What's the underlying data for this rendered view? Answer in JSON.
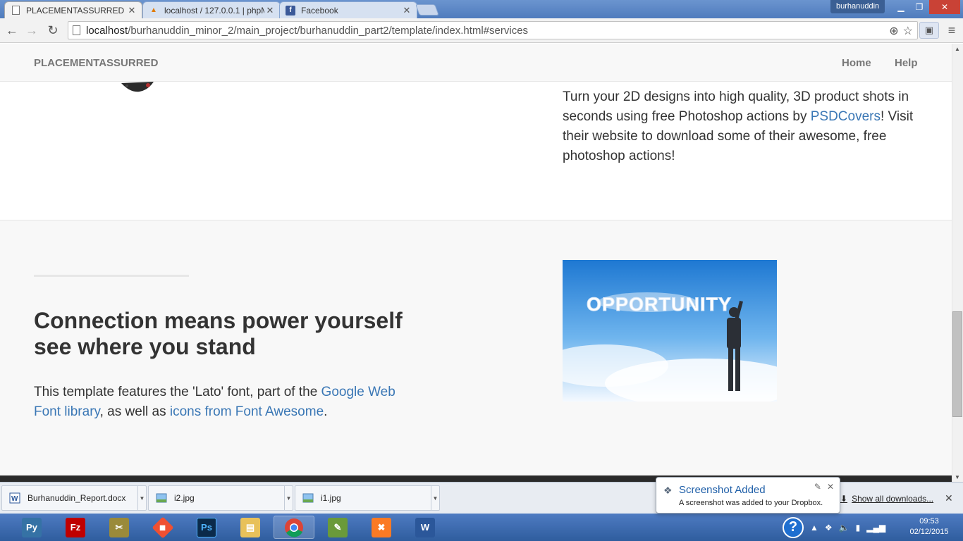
{
  "browser": {
    "tabs": [
      {
        "title": "PLACEMENTASSURRED",
        "active": true,
        "favicon": "page-icon"
      },
      {
        "title": "localhost / 127.0.0.1 | phpMyAdmin",
        "active": false,
        "favicon": "pma-icon"
      },
      {
        "title": "Facebook",
        "active": false,
        "favicon": "facebook-icon"
      }
    ],
    "user": "burhanuddin",
    "url_host": "localhost",
    "url_path": "/burhanuddin_minor_2/main_project/burhanuddin_part2/template/index.html#services"
  },
  "page": {
    "brand": "PLACEMENTASSURRED",
    "nav": {
      "home": "Home",
      "help": "Help"
    },
    "section1": {
      "text_before": "Turn your 2D designs into high quality, 3D product shots in seconds using free Photoshop actions by ",
      "link": "PSDCovers",
      "text_after": "! Visit their website to download some of their awesome, free photoshop actions!"
    },
    "section2": {
      "heading_line1": "Connection means power yourself",
      "heading_line2": "see where you stand",
      "text_a": "This template features the 'Lato' font, part of the ",
      "link_a": "Google Web Font library",
      "text_b": ", as well as ",
      "link_b": "icons from Font Awesome",
      "text_c": ".",
      "image_text": "OPPORTUNITY"
    }
  },
  "downloads": {
    "items": [
      {
        "name": "Burhanuddin_Report.docx",
        "icon": "word-doc-icon"
      },
      {
        "name": "i2.jpg",
        "icon": "image-file-icon"
      },
      {
        "name": "i1.jpg",
        "icon": "image-file-icon"
      }
    ],
    "show_all": "Show all downloads..."
  },
  "notification": {
    "title": "Screenshot Added",
    "body": "A screenshot was added to your Dropbox."
  },
  "taskbar": {
    "apps": [
      "python-icon",
      "filezilla-icon",
      "tools-icon",
      "git-icon",
      "photoshop-icon",
      "explorer-icon",
      "chrome-icon",
      "notepad-icon",
      "xampp-icon",
      "word-icon"
    ],
    "time": "09:53",
    "date": "02/12/2015"
  },
  "colors": {
    "link": "#3a77b5",
    "text": "#333333",
    "navbar": "#f8f8f8"
  }
}
